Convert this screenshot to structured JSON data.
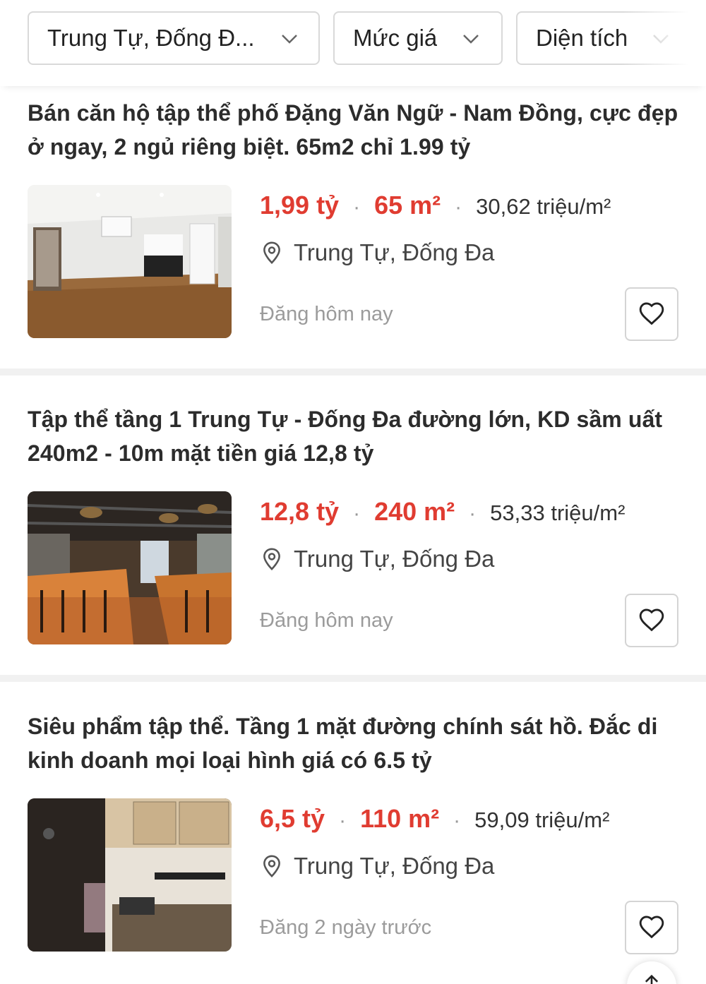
{
  "filters": {
    "location": "Trung Tự, Đống Đ...",
    "price": "Mức giá",
    "area": "Diện tích"
  },
  "listings": [
    {
      "title": "Bán căn hộ tập thể phố Đặng Văn Ngữ - Nam Đồng, cực đẹp ở ngay, 2 ngủ riêng biệt. 65m2 chỉ 1.99 tỷ",
      "price": "1,99 tỷ",
      "area": "65 m²",
      "unit_price": "30,62 triệu/m²",
      "location": "Trung Tự, Đống Đa",
      "posted": "Đăng hôm nay",
      "separator": "·"
    },
    {
      "title": "Tập thể tầng 1 Trung Tự - Đống Đa đường lớn, KD sầm uất 240m2 - 10m mặt tiền giá 12,8 tỷ",
      "price": "12,8 tỷ",
      "area": "240 m²",
      "unit_price": "53,33 triệu/m²",
      "location": "Trung Tự, Đống Đa",
      "posted": "Đăng hôm nay",
      "separator": "·"
    },
    {
      "title": "Siêu phẩm tập thể. Tầng 1 mặt đường chính sát hồ. Đắc di kinh doanh mọi loại hình giá có 6.5 tỷ",
      "price": "6,5 tỷ",
      "area": "110 m²",
      "unit_price": "59,09 triệu/m²",
      "location": "Trung Tự, Đống Đa",
      "posted": "Đăng 2 ngày trước",
      "separator": "·"
    }
  ],
  "icons": {
    "chevron": "chevron-down-icon",
    "location": "location-pin-icon",
    "favorite": "heart-outline-icon",
    "scroll_top": "arrow-up-icon"
  },
  "colors": {
    "accent": "#e03c31",
    "text": "#2c2c2c",
    "muted": "#9b9b9b",
    "border": "#d9d9d9"
  }
}
